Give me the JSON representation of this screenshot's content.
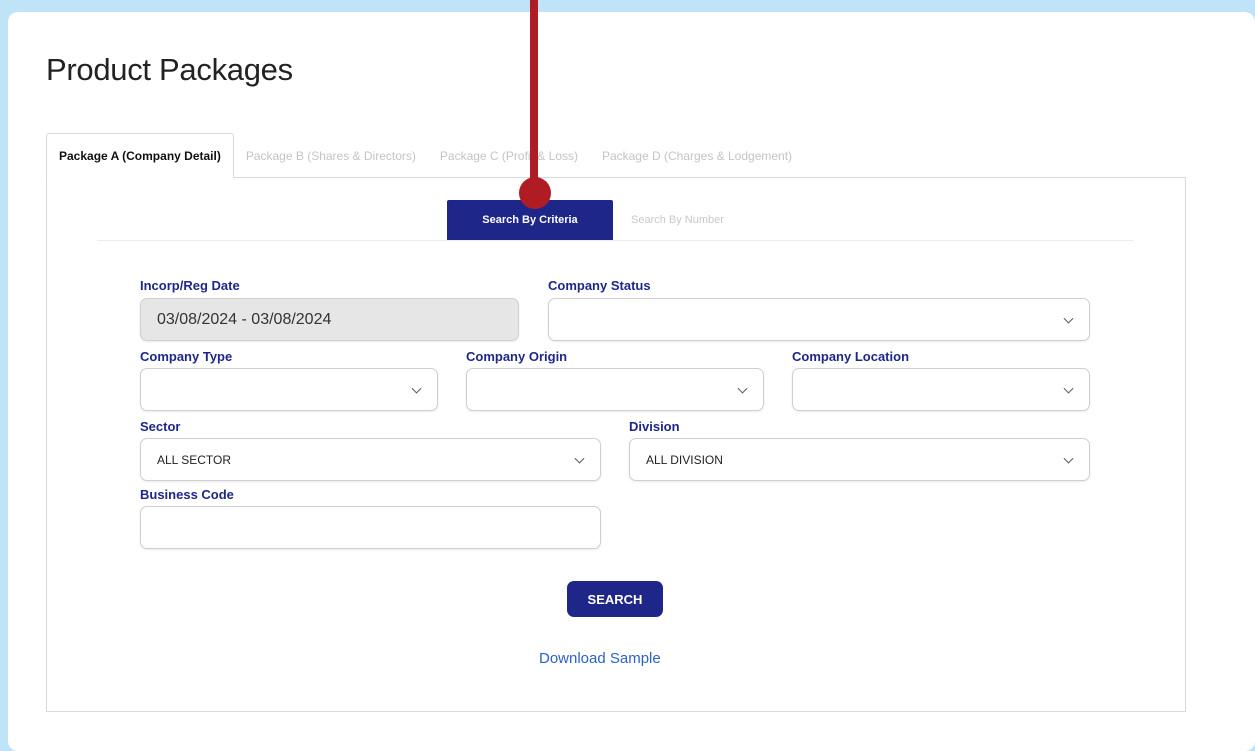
{
  "page": {
    "title": "Product Packages"
  },
  "tabs": [
    {
      "label": "Package A (Company Detail)",
      "active": true
    },
    {
      "label": "Package B (Shares & Directors)",
      "active": false
    },
    {
      "label": "Package C (Profit & Loss)",
      "active": false
    },
    {
      "label": "Package D (Charges & Lodgement)",
      "active": false
    }
  ],
  "subtabs": [
    {
      "label": "Search By Criteria",
      "active": true
    },
    {
      "label": "Search By Number",
      "active": false
    }
  ],
  "form": {
    "incorp_date": {
      "label": "Incorp/Reg Date",
      "value": "03/08/2024 - 03/08/2024"
    },
    "company_status": {
      "label": "Company Status",
      "value": ""
    },
    "company_type": {
      "label": "Company Type",
      "value": ""
    },
    "company_origin": {
      "label": "Company Origin",
      "value": ""
    },
    "company_location": {
      "label": "Company Location",
      "value": ""
    },
    "sector": {
      "label": "Sector",
      "value": "ALL SECTOR"
    },
    "division": {
      "label": "Division",
      "value": "ALL DIVISION"
    },
    "business_code": {
      "label": "Business Code",
      "value": ""
    },
    "search_label": "SEARCH",
    "download_label": "Download Sample"
  },
  "colors": {
    "accent": "#1e2789",
    "annotation": "#b01c24",
    "link": "#2b62c7",
    "background": "#bfe3f7"
  }
}
